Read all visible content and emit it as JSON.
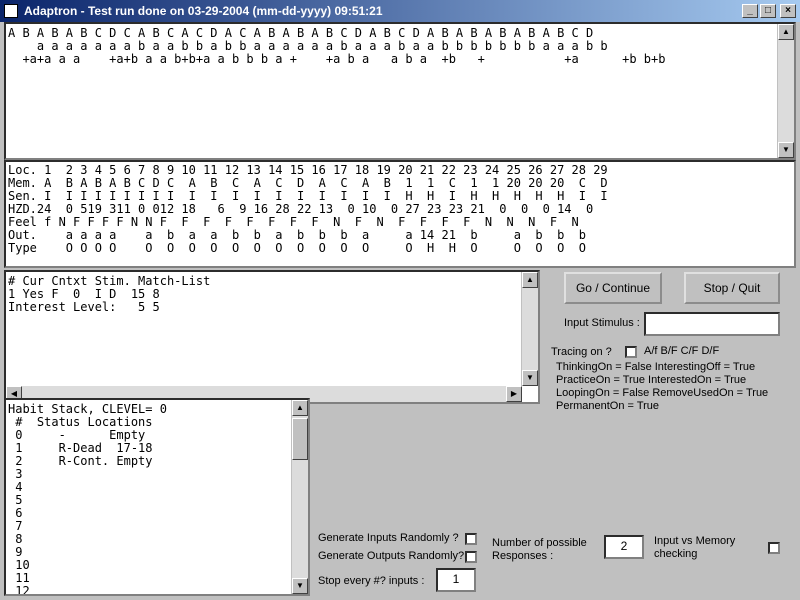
{
  "window": {
    "title": "Adaptron  - Test run done on 03-29-2004 (mm-dd-yyyy) 09:51:21"
  },
  "stim_pane": {
    "lines": [
      "A B A B A B C D C A B C A C D A C A B A B A B C D A B C D A B A B A B A B A B C D",
      "    a a a a a a a b a a b b a b b a a a a a a b a a a b a a b b b b b b b a a a b b",
      "  +a+a a a    +a+b a a b+b+a a b b b a +    +a b a   a b a  +b   +           +a      +b b+b"
    ]
  },
  "memory_table": {
    "rows": [
      "Loc. 1  2 3 4 5 6 7 8 9 10 11 12 13 14 15 16 17 18 19 20 21 22 23 24 25 26 27 28 29",
      "Mem. A  B A B A B C D C  A  B  C  A  C  D  A  C  A  B  1  1  C  1  1 20 20 20  C  D",
      "Sen. I  I I I I I I I I  I  I  I  I  I  I  I  I  I  I  H  H  I  H  H  H  H  H  I  I",
      "HZD.24  0 519 311 0 012 18   6  9 16 28 22 13  0 10  0 27 23 23 21  0  0  0 14  0",
      "Feel f N F F F F N N F  F  F  F  F  F  F  F  N  F  N  F  F  F  F  N  N  N  F  N",
      "Out.    a a a a    a  b  a  a  b  b  a  b  b  b  a     a 14 21  b     a  b  b  b",
      "Type    O O O O    O  O  O  O  O  O  O  O  O  O  O     O  H  H  O     O  O  O  O"
    ]
  },
  "match_pane": {
    "lines": [
      "# Cur Cntxt Stim. Match-List",
      "1 Yes F  0  I D  15 8",
      "Interest Level:   5 5"
    ]
  },
  "habit_pane": {
    "lines": [
      "Habit Stack, CLEVEL= 0",
      " #  Status Locations",
      " 0     -      Empty",
      " 1     R-Dead  17-18",
      " 2     R-Cont. Empty",
      " 3",
      " 4",
      " 5",
      " 6",
      " 7",
      " 8",
      " 9",
      " 10",
      " 11",
      " 12"
    ]
  },
  "controls": {
    "go_label": "Go / Continue",
    "stop_label": "Stop / Quit",
    "input_stimulus_label": "Input Stimulus :",
    "input_stimulus_value": "",
    "tracing_label": "Tracing on ?",
    "tracing_options": "A/f  B/F  C/F  D/F",
    "status": [
      "ThinkingOn = False    InterestingOff = True",
      "PracticeOn = True    InterestedOn = True",
      "LoopingOn = False    RemoveUsedOn = True",
      "PermanentOn = True"
    ]
  },
  "bottom": {
    "gen_inputs_label": "Generate Inputs Randomly ?",
    "gen_outputs_label": "Generate Outputs Randomly?",
    "stop_every_label": "Stop every #? inputs :",
    "stop_every_value": "1",
    "num_responses_label_1": "Number of possible",
    "num_responses_label_2": "Responses :",
    "num_responses_value": "2",
    "input_vs_memory_label_1": "Input vs Memory",
    "input_vs_memory_label_2": "checking"
  }
}
